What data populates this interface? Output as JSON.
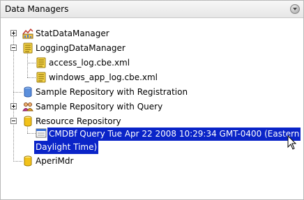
{
  "panel": {
    "title": "Data Managers"
  },
  "tree": {
    "stat_data_manager": "StatDataManager",
    "logging_data_manager": "LoggingDataManager",
    "access_log": "access_log.cbe.xml",
    "windows_app_log": "windows_app_log.cbe.xml",
    "sample_repo_registration": "Sample Repository with Registration",
    "sample_repo_query": "Sample Repository with Query",
    "resource_repository": "Resource Repository",
    "cmdbf_query_line1": "CMDBf Query Tue Apr 22 2008 10:29:34 GMT-0400 (Eastern",
    "cmdbf_query_line2": "Daylight Time)",
    "aperi_mdr": "AperiMdr"
  },
  "colors": {
    "selection": "#0a24c8"
  }
}
